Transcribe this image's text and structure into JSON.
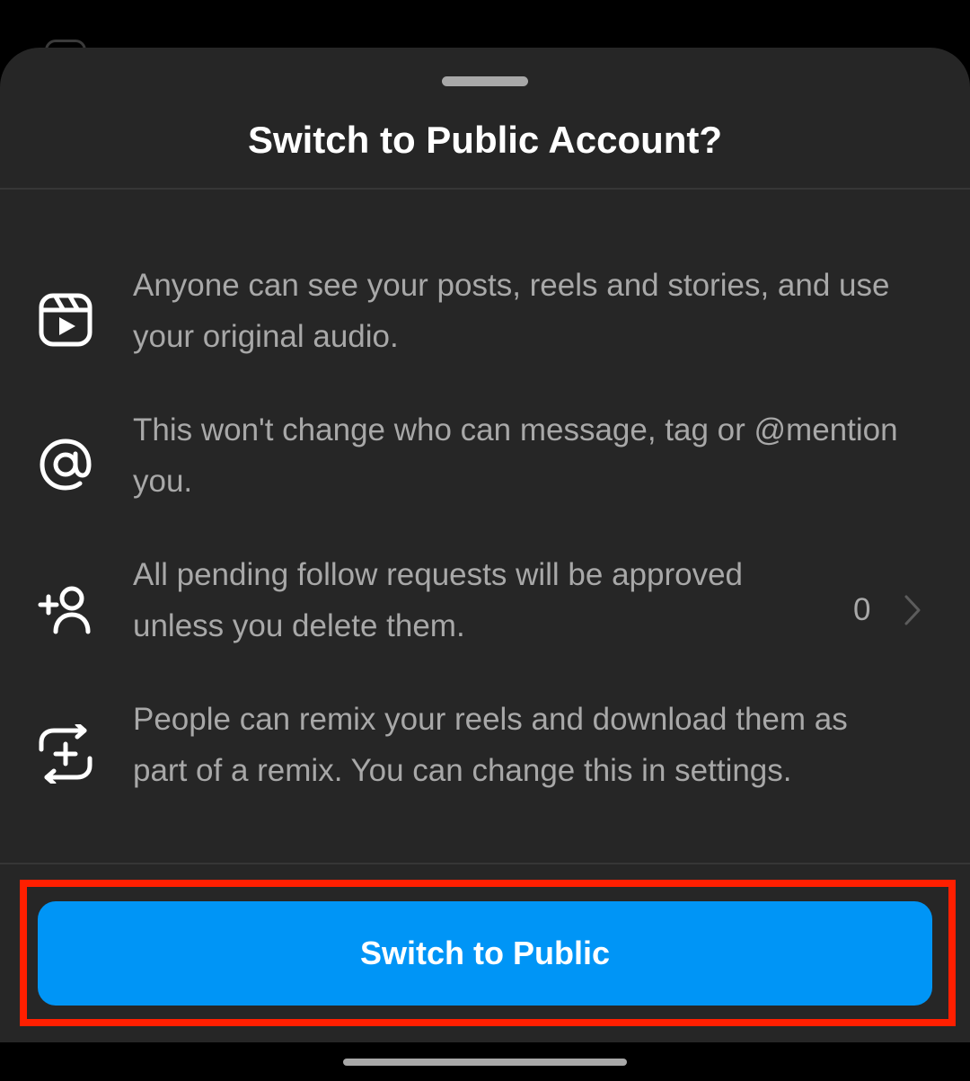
{
  "sheet": {
    "title": "Switch to Public Account?"
  },
  "info_items": [
    {
      "icon": "reels-icon",
      "line1": "Anyone can see your posts, reels and stories, and use",
      "line2": "your original audio."
    },
    {
      "icon": "at-mention-icon",
      "line1": "This won't change who can message, tag or @mention",
      "line2": "you."
    },
    {
      "icon": "add-person-icon",
      "line1": "All pending follow requests will be approved",
      "line2": "unless you delete them.",
      "count": "0"
    },
    {
      "icon": "remix-icon",
      "line1": "People can remix your reels and download them as",
      "line2": "part of a remix. You can change this in settings."
    }
  ],
  "actions": {
    "primary_label": "Switch to Public"
  },
  "colors": {
    "sheet_background": "#262626",
    "primary_text": "#ffffff",
    "secondary_text": "#a8a8a8",
    "primary_button": "#0095f6",
    "highlight_outline": "#ff1f00"
  }
}
